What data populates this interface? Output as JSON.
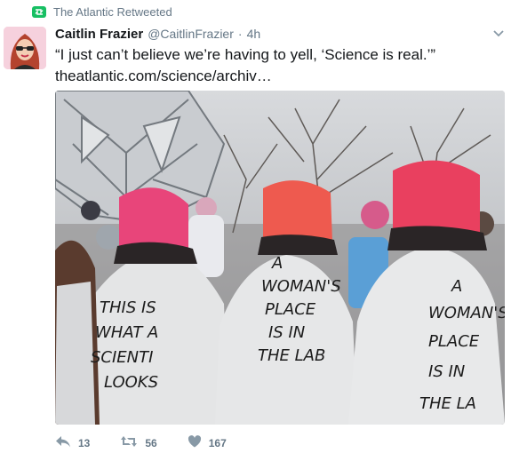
{
  "retweet": {
    "label": "The Atlantic Retweeted",
    "icon": "retweet-icon"
  },
  "author": {
    "name": "Caitlin Frazier",
    "handle": "@CaitlinFrazier",
    "separator": "·",
    "time": "4h"
  },
  "tweet": {
    "text": "“I just can’t believe we’re having to yell, ‘Science is real.’”",
    "link": "theatlantic.com/science/archiv…"
  },
  "photo": {
    "signs": {
      "left": [
        "THIS IS",
        "WHAT A",
        "SCIENTI",
        "LOOKS"
      ],
      "middle": [
        "A",
        "WOMAN'S",
        "PLACE",
        "IS IN",
        "THE LAB"
      ],
      "right": [
        "A",
        "WOMAN'S",
        "PLACE",
        "IS IN",
        "THE LA"
      ]
    }
  },
  "actions": {
    "reply_count": "13",
    "retweet_count": "56",
    "like_count": "167"
  },
  "colors": {
    "accent_green": "#17bf63",
    "text_gray": "#657786",
    "hat_pink": "#e8457a"
  }
}
